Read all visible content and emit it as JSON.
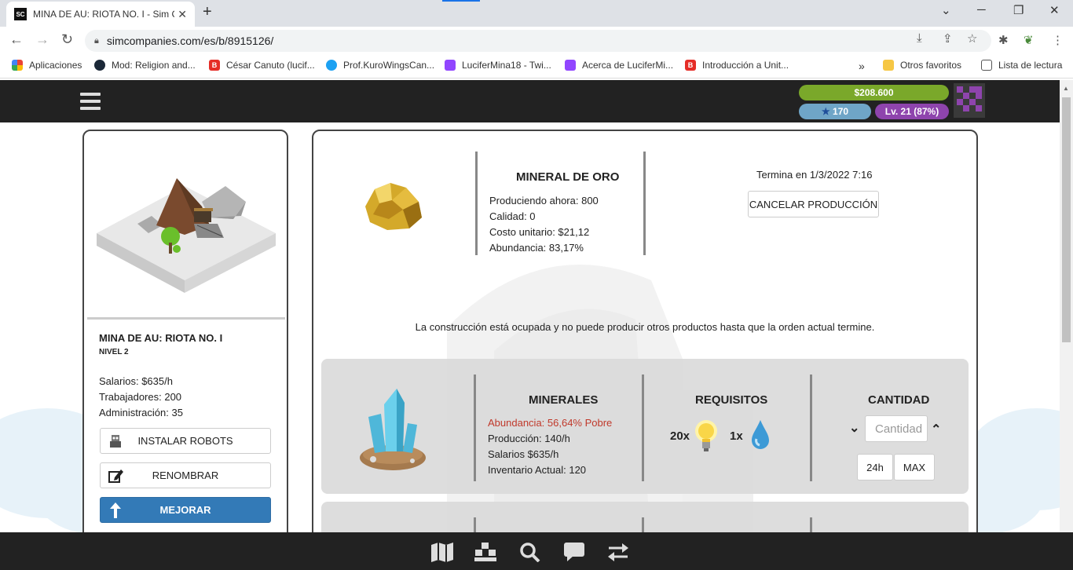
{
  "browser": {
    "tab_title": "MINA DE AU: RIOTA NO. I - Sim C",
    "tab_favicon": "SC",
    "url": "simcompanies.com/es/b/8915126/",
    "bookmarks": [
      {
        "label": "Aplicaciones",
        "icon": "apps-grid-icon",
        "color": "#ea4335"
      },
      {
        "label": "Mod: Religion and...",
        "icon": "steam-icon",
        "color": "#1b2838"
      },
      {
        "label": "César Canuto (lucif...",
        "icon": "blogger-icon",
        "color": "#e52d27"
      },
      {
        "label": "Prof.KuroWingsCan...",
        "icon": "twitter-icon",
        "color": "#1da1f2"
      },
      {
        "label": "LuciferMina18 - Twi...",
        "icon": "twitch-icon",
        "color": "#9146ff"
      },
      {
        "label": "Acerca de LuciferMi...",
        "icon": "twitch-icon",
        "color": "#9146ff"
      },
      {
        "label": "Introducción a Unit...",
        "icon": "blogger-icon",
        "color": "#e52d27"
      }
    ],
    "other_favorites": "Otros favoritos",
    "reading_list": "Lista de lectura"
  },
  "header": {
    "money": "$208.600",
    "stars": "170",
    "level": "Lv. 21 (87%)"
  },
  "building": {
    "name": "MINA DE AU: RIOTA NO. I",
    "level": "NIVEL 2",
    "stats": [
      "Salarios: $635/h",
      "Trabajadores: 200",
      "Administración: 35"
    ],
    "buttons": {
      "robots": "INSTALAR ROBOTS",
      "rename": "RENOMBRAR",
      "upgrade": "MEJORAR"
    }
  },
  "production": {
    "title": "MINERAL DE ORO",
    "lines": [
      "Produciendo ahora: 800",
      "Calidad: 0",
      "Costo unitario: $21,12",
      "Abundancia: 83,17%"
    ],
    "ends": "Termina en 1/3/2022 7:16",
    "cancel": "CANCELAR PRODUCCIÓN",
    "busy_message": "La construcción está ocupada y no puede producir otros productos hasta que la orden actual termine."
  },
  "resource": {
    "title": "MINERALES",
    "abundance": "Abundancia: 56,64% Pobre",
    "lines": [
      "Producción: 140/h",
      "Salarios $635/h",
      "Inventario Actual: 120"
    ],
    "requirements_title": "REQUISITOS",
    "requirements": [
      {
        "amount": "20x",
        "icon": "lightbulb-icon"
      },
      {
        "amount": "1x",
        "icon": "water-drop-icon"
      }
    ],
    "quantity_title": "CANTIDAD",
    "quantity_placeholder": "Cantidad",
    "btn_24h": "24h",
    "btn_max": "MAX"
  },
  "colors": {
    "money": "#7aa82a",
    "stars": "#6fa5c7",
    "level": "#8e44ad",
    "primary": "#337ab7",
    "abundance_poor": "#c0392b"
  }
}
